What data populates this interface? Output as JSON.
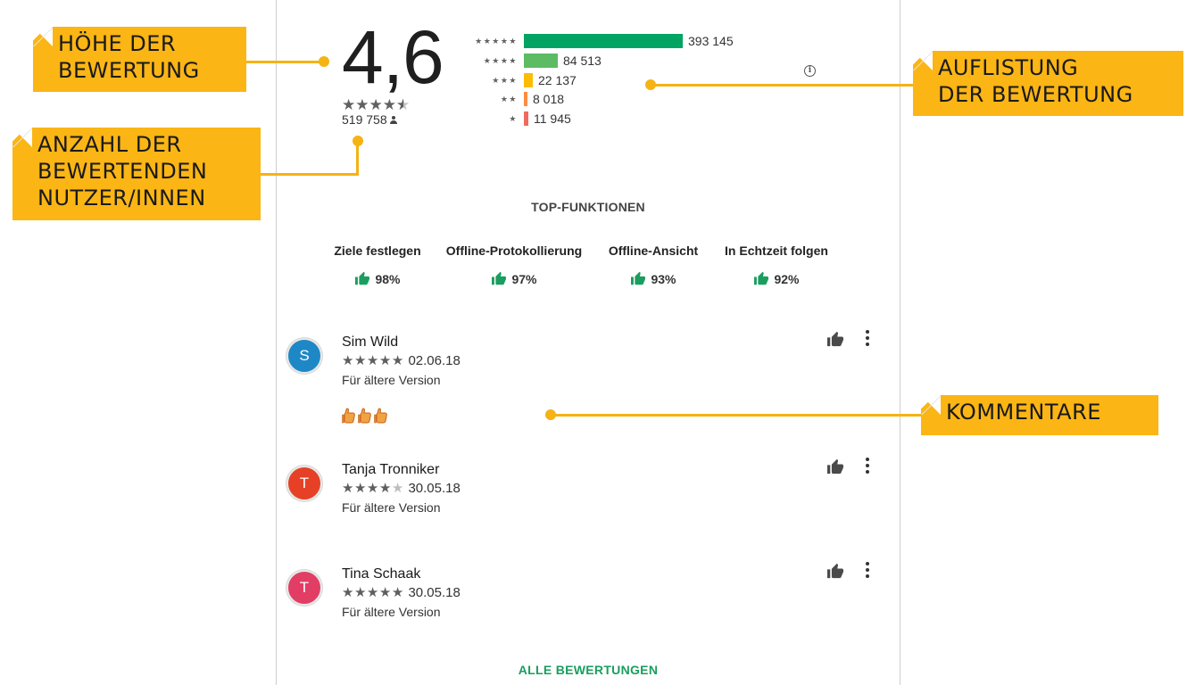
{
  "summary": {
    "average": "4,6",
    "average_value": 4.6,
    "rater_count": "519 758"
  },
  "histogram": [
    {
      "stars": "★★★★★",
      "count": "393 145",
      "value": 393145,
      "color": "#01a462"
    },
    {
      "stars": "★★★★",
      "count": "84 513",
      "value": 84513,
      "color": "#5dbb63"
    },
    {
      "stars": "★★★",
      "count": "22 137",
      "value": 22137,
      "color": "#fbbc05"
    },
    {
      "stars": "★★",
      "count": "8 018",
      "value": 8018,
      "color": "#fb8c41"
    },
    {
      "stars": "★",
      "count": "11 945",
      "value": 11945,
      "color": "#ee6b5f"
    }
  ],
  "top_features": {
    "title": "TOP-FUNKTIONEN",
    "items": [
      {
        "name": "Ziele festlegen",
        "percent": "98%"
      },
      {
        "name": "Offline-Protokollierung",
        "percent": "97%"
      },
      {
        "name": "Offline-Ansicht",
        "percent": "93%"
      },
      {
        "name": "In Echtzeit folgen",
        "percent": "92%"
      }
    ]
  },
  "reviews": [
    {
      "initial": "S",
      "name": "Sim Wild",
      "stars": 5,
      "date": "02.06.18",
      "version": "Für ältere Version",
      "avatar_color": "#1e88c7",
      "emoji_count": 3
    },
    {
      "initial": "T",
      "name": "Tanja Tronniker",
      "stars": 4,
      "date": "30.05.18",
      "version": "Für ältere Version",
      "avatar_color": "#e64126",
      "emoji_count": 0
    },
    {
      "initial": "T",
      "name": "Tina Schaak",
      "stars": 5,
      "date": "30.05.18",
      "version": "Für ältere Version",
      "avatar_color": "#e23d64",
      "emoji_count": 0
    }
  ],
  "all_reviews_label": "ALLE BEWERTUNGEN",
  "callouts": {
    "rating_height": [
      "HÖHE DER",
      "BEWERTUNG"
    ],
    "rater_count": [
      "ANZAHL DER",
      "BEWERTENDEN",
      "NUTZER/INNEN"
    ],
    "rating_list": [
      "AUFLISTUNG",
      "DER BEWERTUNG"
    ],
    "comments": [
      "KOMMENTARE"
    ]
  },
  "colors": {
    "accent_green": "#1a9e5f",
    "callout_yellow": "#fbb515"
  },
  "icons": [
    "info-icon",
    "thumbs-up-icon",
    "more-vert-icon",
    "person-icon",
    "thumbs-up-emoji-icon"
  ]
}
